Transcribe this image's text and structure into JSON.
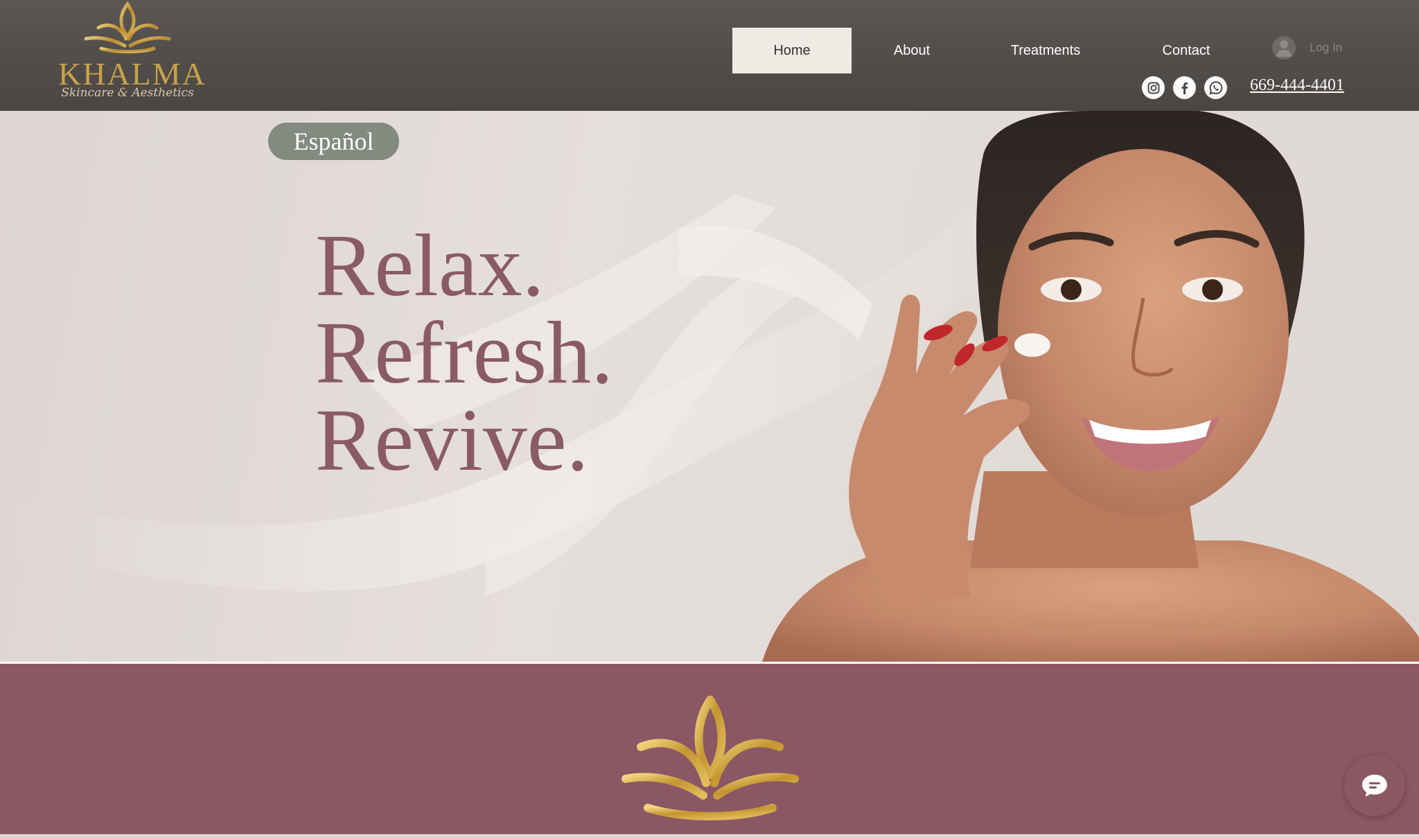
{
  "brand": {
    "name": "KHALMA",
    "tagline": "Skincare & Aesthetics",
    "gold": "#c9a24a"
  },
  "nav": {
    "items": [
      {
        "label": "Home",
        "active": true
      },
      {
        "label": "About",
        "active": false
      },
      {
        "label": "Treatments",
        "active": false
      },
      {
        "label": "Contact",
        "active": false
      }
    ],
    "login_label": "Log In"
  },
  "socials": [
    {
      "icon": "instagram-icon"
    },
    {
      "icon": "facebook-icon"
    },
    {
      "icon": "whatsapp-icon"
    }
  ],
  "phone": "669-444-4401",
  "hero": {
    "language_button": "Español",
    "lines": [
      "Relax.",
      "Refresh.",
      "Revive."
    ],
    "headline_color": "#8b5a67"
  },
  "band": {
    "color": "#8a5764"
  },
  "chat": {
    "icon": "chat-bubble-icon"
  }
}
